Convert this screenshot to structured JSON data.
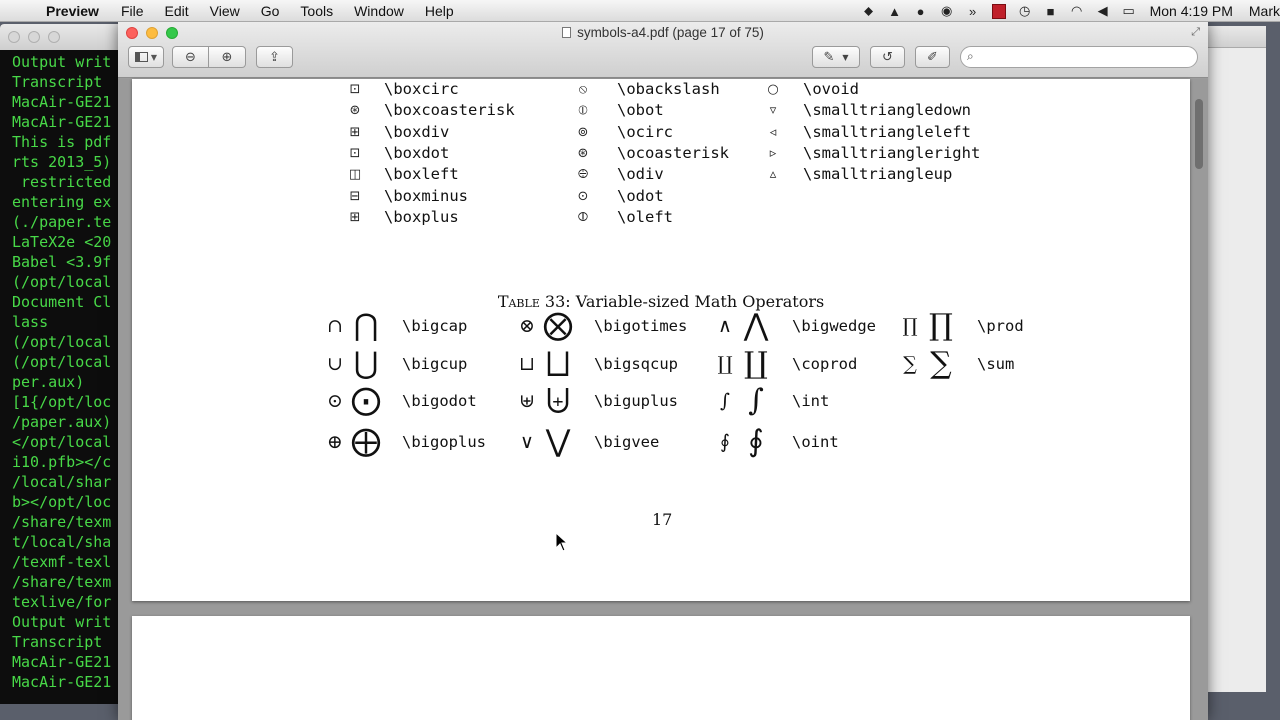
{
  "menubar": {
    "app_name": "Preview",
    "items": [
      "File",
      "Edit",
      "View",
      "Go",
      "Tools",
      "Window",
      "Help"
    ],
    "clock": "Mon 4:19 PM",
    "user": "Mark"
  },
  "terminal": {
    "lines": [
      "Output writ",
      "Transcript",
      "MacAir-GE21",
      "MacAir-GE21",
      "This is pdf",
      "rts 2013_5)",
      " restricted",
      "entering ex",
      "(./paper.te",
      "LaTeX2e <20",
      "Babel <3.9f",
      "(/opt/local",
      "Document Cl",
      "lass",
      "(/opt/local",
      "(/opt/local",
      "per.aux)",
      "[1{/opt/loc",
      "/paper.aux)",
      "</opt/local",
      "i10.pfb></c",
      "/local/shar",
      "b></opt/loc",
      "/share/texm",
      "t/local/sha",
      "/texmf-texl",
      "/share/texm",
      "texlive/for",
      "Output writ",
      "Transcript",
      "MacAir-GE21",
      "MacAir-GE21"
    ]
  },
  "window": {
    "title": "symbols-a4.pdf (page 17 of 75)",
    "search_placeholder": ""
  },
  "symbol_columns": [
    {
      "glyphs": [
        "⊡",
        "⊛",
        "⊞",
        "⊡",
        "◫",
        "⊟",
        "⊞"
      ],
      "names": [
        "\\boxcirc",
        "\\boxcoasterisk",
        "\\boxdiv",
        "\\boxdot",
        "\\boxleft",
        "\\boxminus",
        "\\boxplus"
      ]
    },
    {
      "glyphs": [
        "⦸",
        "⦶",
        "⊚",
        "⊛",
        "⨸",
        "⊙",
        "⦷"
      ],
      "names": [
        "\\obackslash",
        "\\obot",
        "\\ocirc",
        "\\ocoasterisk",
        "\\odiv",
        "\\odot",
        "\\oleft"
      ]
    },
    {
      "glyphs": [
        "○",
        "▿",
        "◃",
        "▹",
        "▵"
      ],
      "names": [
        "\\ovoid",
        "\\smalltriangledown",
        "\\smalltriangleleft",
        "\\smalltriangleright",
        "\\smalltriangleup"
      ]
    }
  ],
  "table33": {
    "caption_prefix": "Table 33:",
    "caption_title": "Variable-sized Math Operators",
    "columns": [
      [
        {
          "small": "∩",
          "large": "⋂",
          "cmd": "\\bigcap"
        },
        {
          "small": "∪",
          "large": "⋃",
          "cmd": "\\bigcup"
        },
        {
          "small": "⊙",
          "large": "⨀",
          "cmd": "\\bigodot"
        },
        {
          "small": "⊕",
          "large": "⨁",
          "cmd": "\\bigoplus"
        }
      ],
      [
        {
          "small": "⊗",
          "large": "⨂",
          "cmd": "\\bigotimes"
        },
        {
          "small": "⊔",
          "large": "⨆",
          "cmd": "\\bigsqcup"
        },
        {
          "small": "⊎",
          "large": "⨄",
          "cmd": "\\biguplus"
        },
        {
          "small": "∨",
          "large": "⋁",
          "cmd": "\\bigvee"
        }
      ],
      [
        {
          "small": "∧",
          "large": "⋀",
          "cmd": "\\bigwedge"
        },
        {
          "small": "∐",
          "large": "∐",
          "cmd": "\\coprod"
        },
        {
          "small": "∫",
          "large": "∫",
          "cmd": "\\int"
        },
        {
          "small": "∮",
          "large": "∮",
          "cmd": "\\oint"
        }
      ],
      [
        {
          "small": "∏",
          "large": "∏",
          "cmd": "\\prod"
        },
        {
          "small": "∑",
          "large": "∑",
          "cmd": "\\sum"
        }
      ]
    ]
  },
  "page_number": "17"
}
